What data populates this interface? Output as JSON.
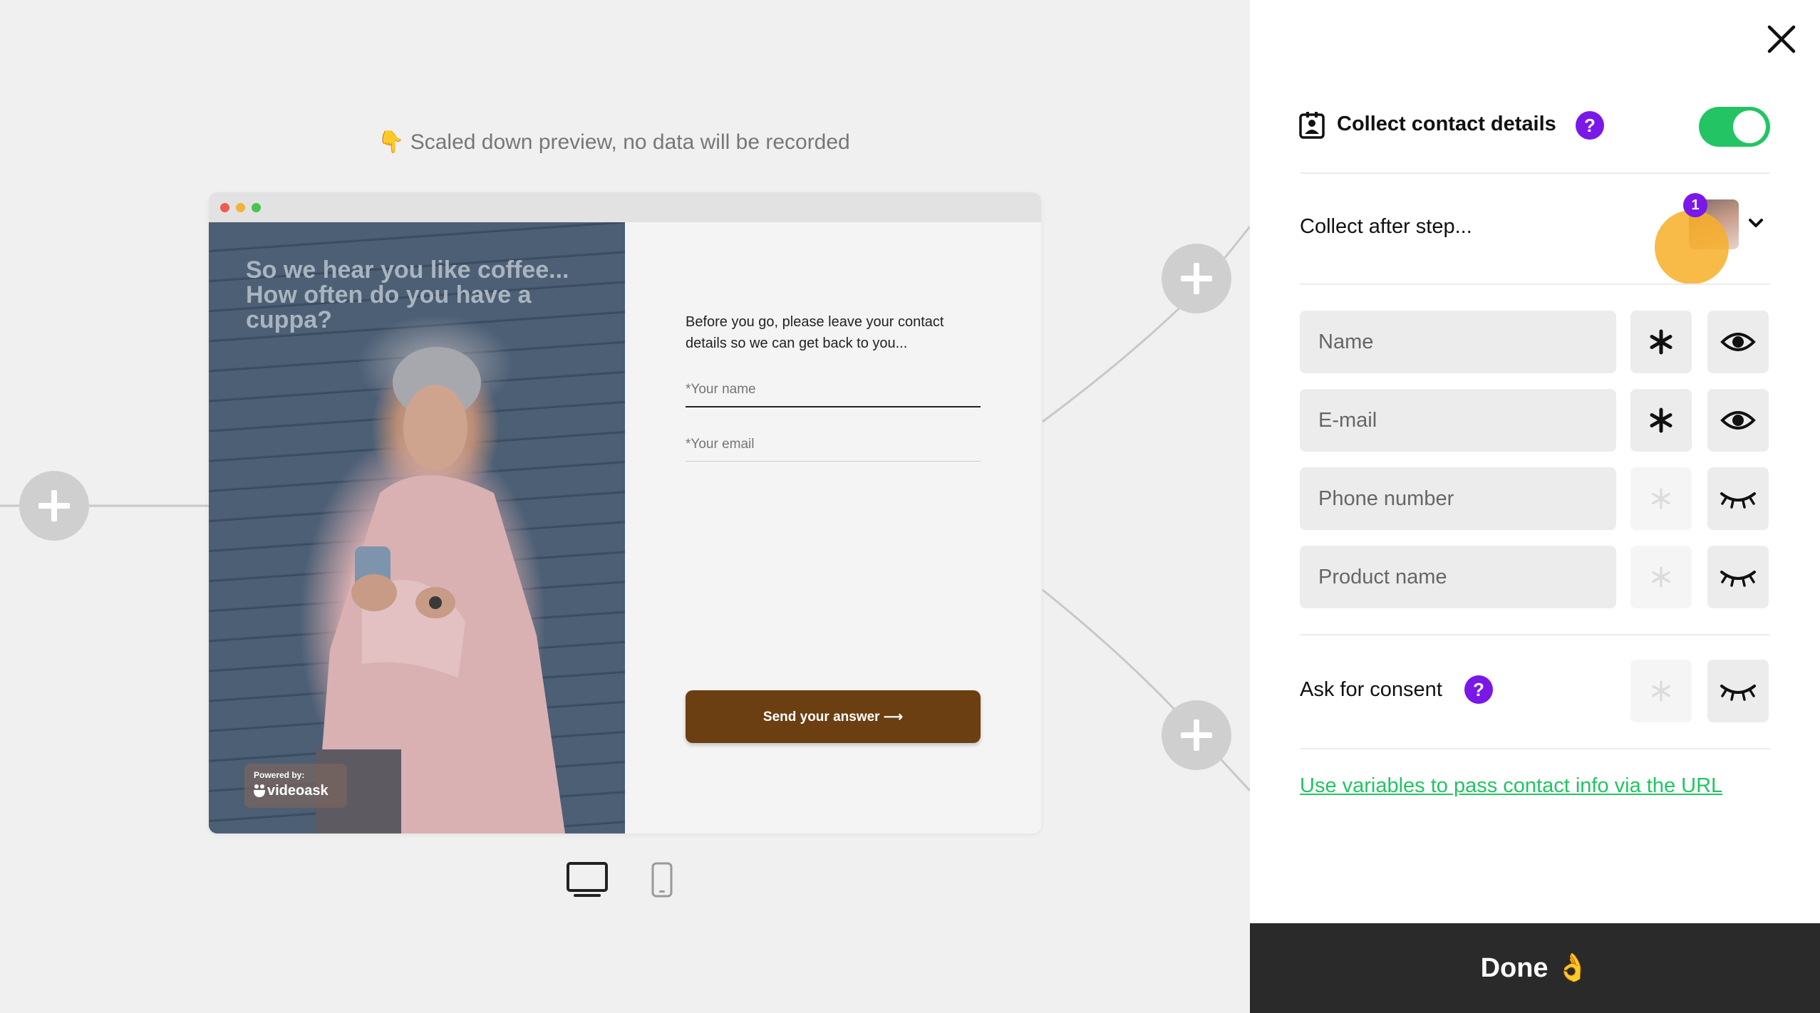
{
  "canvas": {
    "preview_note_emoji": "👇",
    "preview_note": "Scaled down preview, no data will be recorded"
  },
  "preview": {
    "video_question": "So we hear you like coffee... How often do you have a cuppa?",
    "powered_by_label": "Powered by:",
    "brand": "videoask",
    "form_intro": "Before you go, please leave your contact details so we can get back to you...",
    "name_placeholder": "*Your name",
    "email_placeholder": "*Your email",
    "send_button": "Send your answer ⟶",
    "send_button_color": "#6b3f12"
  },
  "panel": {
    "title": "Collect contact details",
    "help_symbol": "?",
    "enabled": true,
    "collect_after_label": "Collect after step...",
    "step_badge": "1",
    "fields": [
      {
        "label": "Name",
        "required": true,
        "visible": true
      },
      {
        "label": "E-mail",
        "required": true,
        "visible": true
      },
      {
        "label": "Phone number",
        "required": false,
        "visible": false
      },
      {
        "label": "Product name",
        "required": false,
        "visible": false
      }
    ],
    "consent_label": "Ask for consent",
    "url_link": "Use variables to pass contact info via the URL",
    "done_button": "Done 👌",
    "accent_color": "#22c463",
    "help_color": "#7a18e8"
  }
}
